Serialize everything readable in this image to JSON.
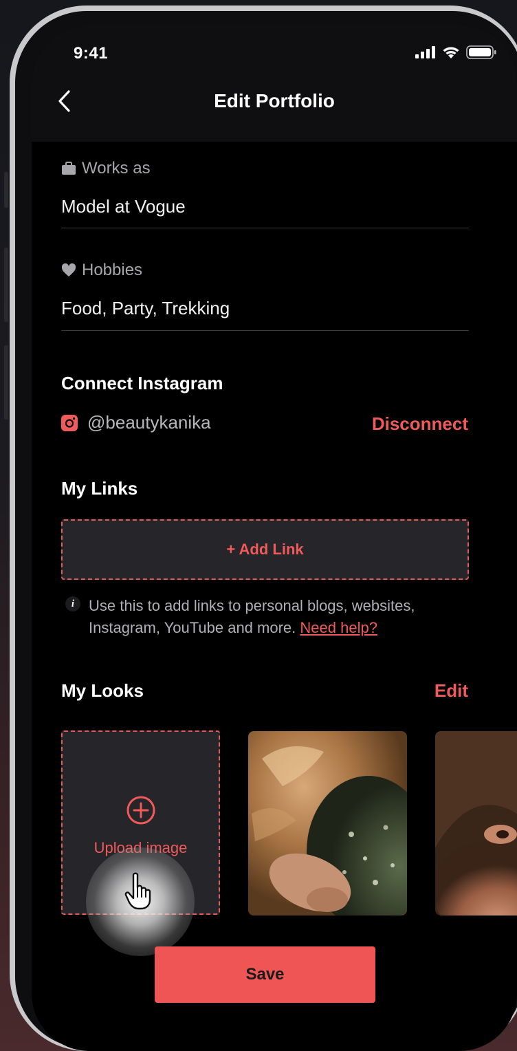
{
  "status_bar": {
    "time": "9:41"
  },
  "header": {
    "title": "Edit Portfolio"
  },
  "works_as": {
    "label": "Works as",
    "value": "Model at Vogue"
  },
  "hobbies": {
    "label": "Hobbies",
    "value": "Food, Party, Trekking"
  },
  "instagram": {
    "section_title": "Connect Instagram",
    "handle": "@beautykanika",
    "disconnect_label": "Disconnect"
  },
  "links": {
    "section_title": "My Links",
    "add_label": "+ Add Link",
    "info_text": "Use this to add links to personal blogs, websites, Instagram, YouTube and more.",
    "help_label": "Need help?"
  },
  "looks": {
    "section_title": "My Looks",
    "edit_label": "Edit",
    "upload_label": "Upload image"
  },
  "footer": {
    "save_label": "Save"
  },
  "colors": {
    "accent": "#F05A5A",
    "background": "#000000",
    "card": "#26262A"
  }
}
